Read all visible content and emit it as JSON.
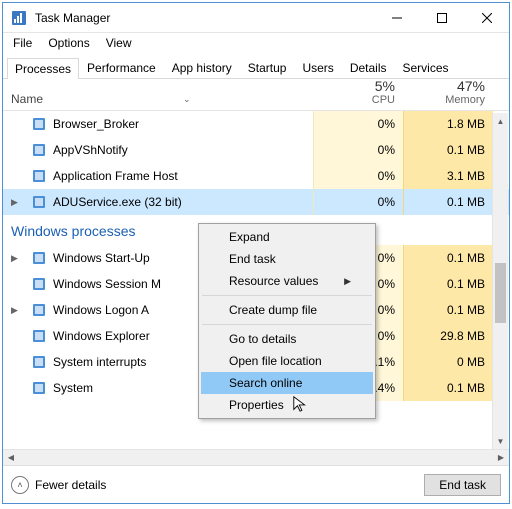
{
  "window": {
    "title": "Task Manager"
  },
  "menubar": [
    "File",
    "Options",
    "View"
  ],
  "tabs": [
    "Processes",
    "Performance",
    "App history",
    "Startup",
    "Users",
    "Details",
    "Services"
  ],
  "active_tab": 0,
  "columns": {
    "name_label": "Name",
    "cpu": {
      "pct": "5%",
      "label": "CPU"
    },
    "memory": {
      "pct": "47%",
      "label": "Memory"
    }
  },
  "group_header": "Windows processes",
  "rows_top": [
    {
      "name": "Browser_Broker",
      "cpu": "0%",
      "mem": "1.8 MB"
    },
    {
      "name": "AppVShNotify",
      "cpu": "0%",
      "mem": "0.1 MB"
    },
    {
      "name": "Application Frame Host",
      "cpu": "0%",
      "mem": "3.1 MB"
    },
    {
      "name": "ADUService.exe (32 bit)",
      "cpu": "0%",
      "mem": "0.1 MB",
      "selected": true,
      "expandable": true
    }
  ],
  "rows_bottom": [
    {
      "name": "Windows Start-Up",
      "cpu": "0%",
      "mem": "0.1 MB",
      "expandable": true
    },
    {
      "name": "Windows Session M",
      "cpu": "0%",
      "mem": "0.1 MB"
    },
    {
      "name": "Windows Logon A",
      "cpu": "0%",
      "mem": "0.1 MB",
      "expandable": true
    },
    {
      "name": "Windows Explorer",
      "cpu": "0%",
      "mem": "29.8 MB"
    },
    {
      "name": "System interrupts",
      "cpu": "0.1%",
      "mem": "0 MB"
    },
    {
      "name": "System",
      "cpu": "0.4%",
      "mem": "0.1 MB"
    }
  ],
  "context_menu": {
    "items": [
      {
        "label": "Expand",
        "type": "item"
      },
      {
        "label": "End task",
        "type": "item"
      },
      {
        "label": "Resource values",
        "type": "submenu"
      },
      {
        "type": "sep"
      },
      {
        "label": "Create dump file",
        "type": "item"
      },
      {
        "type": "sep"
      },
      {
        "label": "Go to details",
        "type": "item"
      },
      {
        "label": "Open file location",
        "type": "item"
      },
      {
        "label": "Search online",
        "type": "item",
        "highlight": true
      },
      {
        "label": "Properties",
        "type": "item"
      }
    ]
  },
  "footer": {
    "fewer_label": "Fewer details",
    "end_task_label": "End task"
  }
}
